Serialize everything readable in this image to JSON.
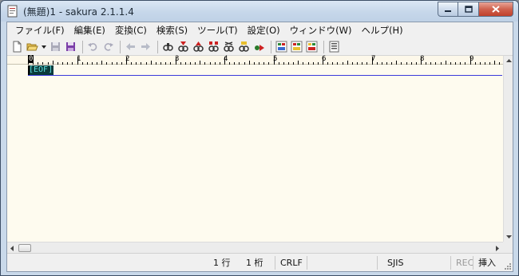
{
  "window": {
    "title": "(無題)1 - sakura 2.1.1.4"
  },
  "menu": {
    "items": [
      {
        "label": "ファイル(F)"
      },
      {
        "label": "編集(E)"
      },
      {
        "label": "変換(C)"
      },
      {
        "label": "検索(S)"
      },
      {
        "label": "ツール(T)"
      },
      {
        "label": "設定(O)"
      },
      {
        "label": "ウィンドウ(W)"
      },
      {
        "label": "ヘルプ(H)"
      }
    ]
  },
  "toolbar": {
    "icons": [
      "new-file-icon",
      "open-folder-icon",
      "dropdown-icon",
      "save-icon",
      "save-all-icon",
      "undo-icon",
      "redo-icon",
      "jump-back-icon",
      "jump-forward-icon",
      "search-icon",
      "search-next-icon",
      "search-prev-icon",
      "grep-icon",
      "replace-icon",
      "bookmark-icon",
      "jump-icon",
      "outline-icon",
      "tag-jump-icon",
      "macro-icon",
      "settings-icon"
    ]
  },
  "ruler": {
    "labels": [
      "0",
      "1",
      "2",
      "3",
      "4",
      "5",
      "6",
      "7",
      "8",
      "9"
    ]
  },
  "editor": {
    "eof_marker": "[EOF]"
  },
  "statusbar": {
    "line": "1 行",
    "column": "1 桁",
    "line_ending": "CRLF",
    "encoding": "SJIS",
    "rec": "REC",
    "mode": "挿入"
  },
  "colors": {
    "editor_background": "#fefbef",
    "eof_background": "#0a3a3a",
    "eof_text": "#5fe0e0",
    "cursor_line": "#3a3adb"
  }
}
